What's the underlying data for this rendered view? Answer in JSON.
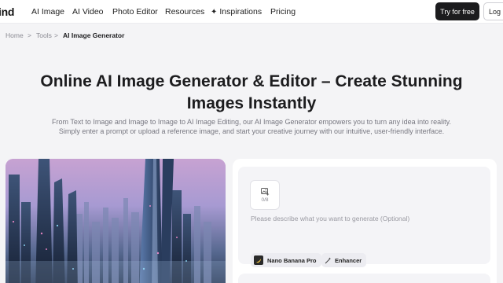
{
  "header": {
    "logo": "ind",
    "nav": [
      "AI Image",
      "AI Video",
      "Photo Editor",
      "Resources",
      "Inspirations",
      "Pricing"
    ],
    "try_label": "Try for free",
    "login_label": "Log i"
  },
  "breadcrumb": {
    "items": [
      "Home",
      "Tools",
      "AI Image Generator"
    ],
    "separator": ">"
  },
  "hero": {
    "title": "Online AI Image Generator & Editor – Create Stunning Images Instantly",
    "description": "From Text to Image and Image to Image to AI Image Editing, our AI Image Generator empowers you to turn any idea into reality. Simply enter a prompt or upload a reference image, and start your creative journey with our intuitive, user-friendly interface."
  },
  "generator": {
    "upload_count": "0/8",
    "prompt_placeholder": "Please describe what you want to generate (Optional)",
    "model_label": "Nano Banana Pro",
    "enhancer_label": "Enhancer"
  },
  "icons": {
    "upload": "image-plus-icon",
    "inspirations": "sparkle-icon",
    "model": "banana-logo-icon",
    "enhancer": "magic-wand-icon"
  },
  "colors": {
    "primary_button": "#1c1c1e",
    "page_bg": "#f4f4f6",
    "panel_bg": "#ffffff"
  }
}
